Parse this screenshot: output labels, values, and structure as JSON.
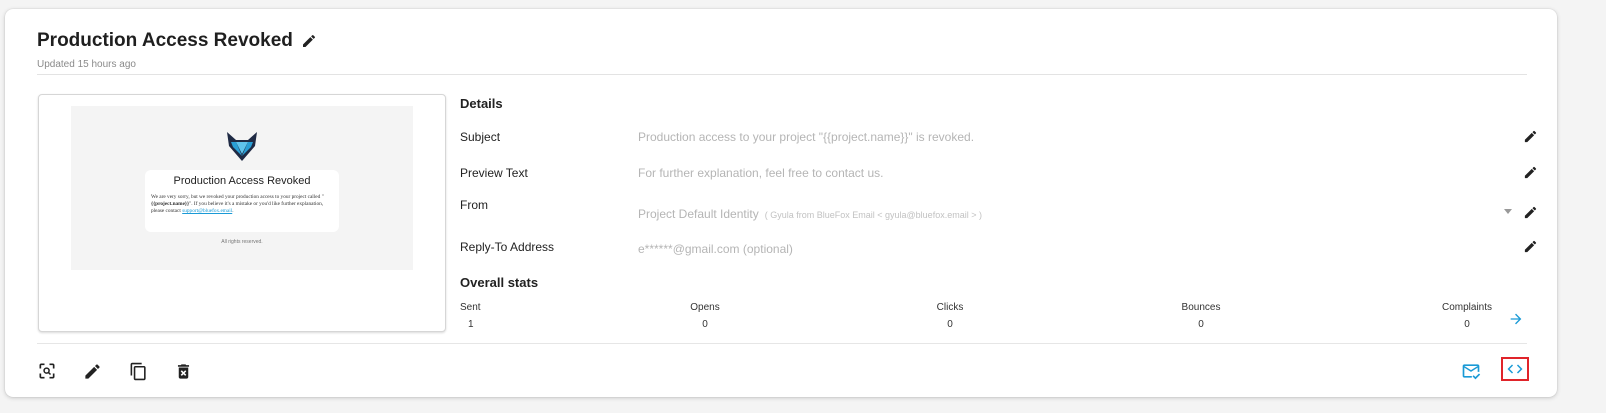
{
  "template": {
    "title": "Production Access Revoked",
    "updated": "Updated 15 hours ago"
  },
  "preview": {
    "email_title": "Production Access Revoked",
    "body_part1": "We are very sorry, but we revoked your production access to your project called \"",
    "body_bold": "{{project.name}}",
    "body_part2": "\". If you believe it's a mistake or you'd like further explanation, please contact ",
    "body_link": "support@bluefox.email",
    "body_end": ".",
    "footer": "All rights reserved."
  },
  "details": {
    "title": "Details",
    "subject_label": "Subject",
    "subject_value": "Production access to your project \"{{project.name}}\" is revoked.",
    "preview_label": "Preview Text",
    "preview_value": "For further explanation, feel free to contact us.",
    "from_label": "From",
    "from_value": "Project Default Identity",
    "from_sub": "( Gyula from BlueFox Email < gyula@bluefox.email > )",
    "replyto_label": "Reply-To Address",
    "replyto_value": "e******@gmail.com (optional)"
  },
  "stats": {
    "title": "Overall stats",
    "sent_label": "Sent",
    "sent_value": "1",
    "opens_label": "Opens",
    "opens_value": "0",
    "clicks_label": "Clicks",
    "clicks_value": "0",
    "bounces_label": "Bounces",
    "bounces_value": "0",
    "complaints_label": "Complaints",
    "complaints_value": "0"
  },
  "colors": {
    "accent": "#1a9ad6",
    "highlight": "#e0242a"
  },
  "icons": [
    "pencil-icon",
    "preview-search-icon",
    "copy-icon",
    "delete-icon",
    "arrow-right-icon",
    "send-test-email-icon",
    "code-icon",
    "bluefox-logo-icon"
  ]
}
